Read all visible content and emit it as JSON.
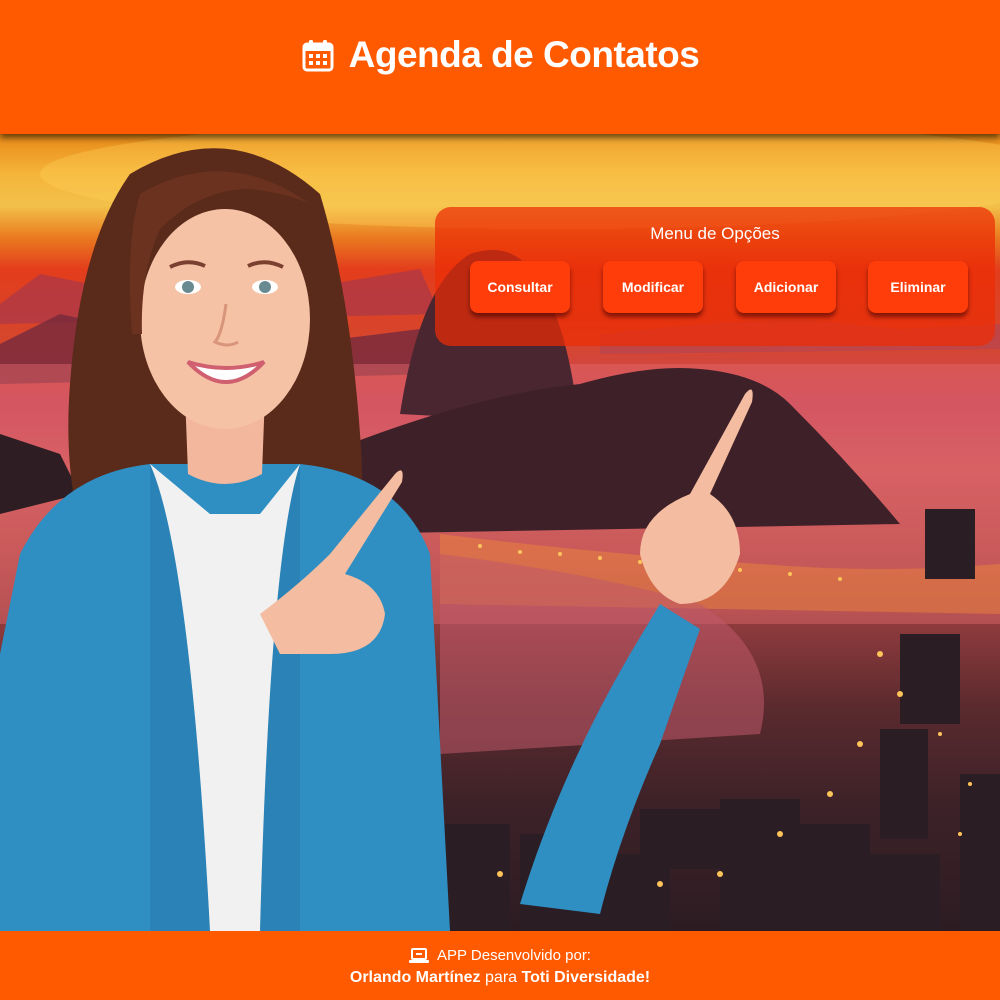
{
  "header": {
    "title": "Agenda de Contatos",
    "icon": "calendar-icon"
  },
  "menu": {
    "title": "Menu de Opções",
    "buttons": [
      "Consultar",
      "Modificar",
      "Adicionar",
      "Eliminar"
    ]
  },
  "footer": {
    "icon": "laptop-icon",
    "line1": "APP Desenvolvido por:",
    "author": "Orlando Martínez",
    "connector": "para",
    "organization": "Toti Diversidade!"
  },
  "colors": {
    "brand_orange": "#ff5a00",
    "button_red": "#ff3d0a",
    "text": "#ffffff"
  }
}
